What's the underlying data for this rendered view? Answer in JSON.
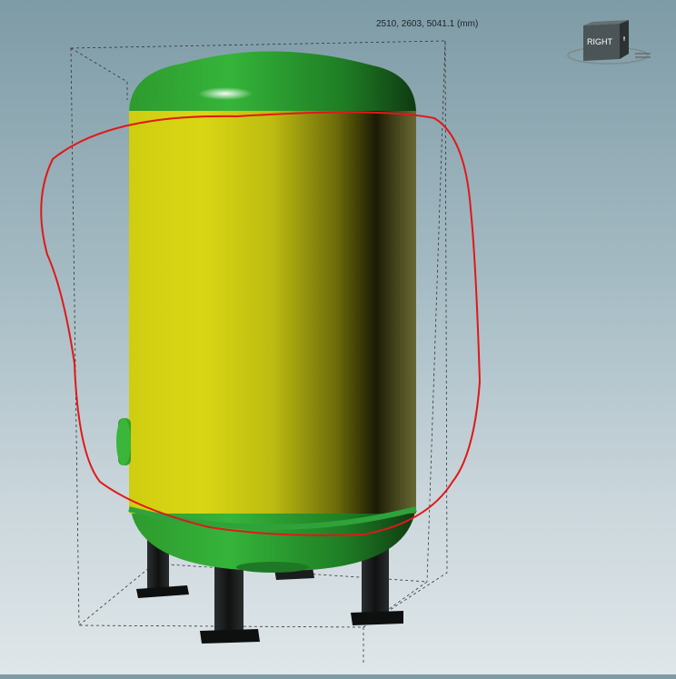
{
  "viewport": {
    "dimensions_readout": "2510, 2603, 5041.1 (mm)"
  },
  "view_cube": {
    "face_label": "RIGHT"
  },
  "model": {
    "body_color": "#d6d412",
    "head_color": "#2fa33a",
    "leg_color": "#1c1f1f",
    "annotation_color": "#e01818"
  },
  "icons": [
    "view-cube-icon"
  ]
}
